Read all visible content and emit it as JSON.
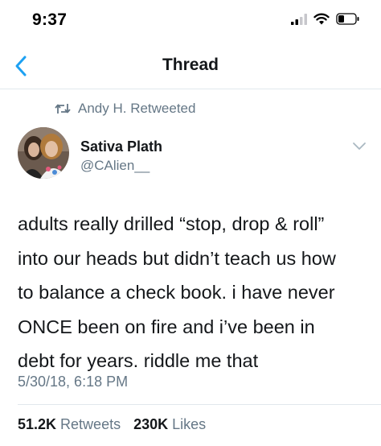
{
  "status_bar": {
    "time": "9:37"
  },
  "header": {
    "title": "Thread"
  },
  "retweet_context": {
    "text": "Andy H. Retweeted"
  },
  "tweet": {
    "display_name": "Sativa Plath",
    "handle": "@CAlien__",
    "text_lines": [
      "adults really drilled “stop, drop & roll”",
      "into our heads but didn’t teach us how",
      "to balance a check book. i have never",
      "ONCE been on fire and i’ve been in",
      "debt for years. riddle me that"
    ],
    "timestamp": "5/30/18, 6:18 PM",
    "retweets_count": "51.2K",
    "retweets_label": "Retweets",
    "likes_count": "230K",
    "likes_label": "Likes"
  },
  "colors": {
    "accent": "#1da1f2",
    "secondary_text": "#657786",
    "primary_text": "#14171a",
    "divider": "#e1e8ed"
  },
  "icons": [
    "signal-icon",
    "wifi-icon",
    "battery-icon",
    "back-chevron-icon",
    "retweet-icon",
    "chevron-down-icon"
  ]
}
